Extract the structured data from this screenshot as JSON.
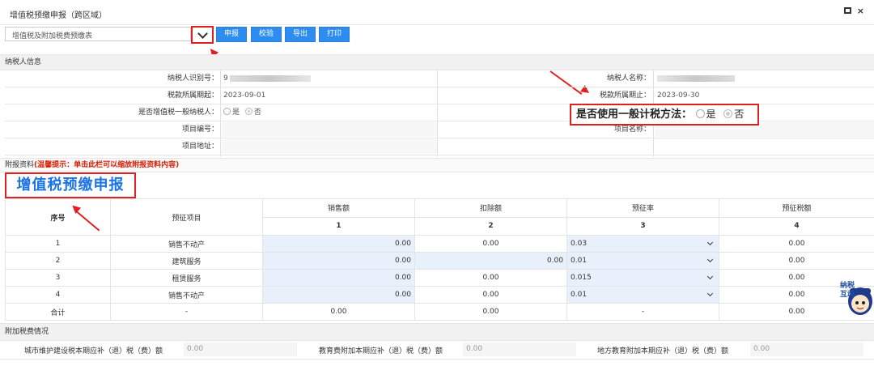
{
  "window": {
    "title": "增值税预缴申报（跨区域）"
  },
  "toolbar": {
    "form_select": "增值税及附加税费预缴表",
    "buttons": {
      "declare": "申报",
      "verify": "校验",
      "export": "导出",
      "print": "打印"
    }
  },
  "taxpayer_section": {
    "title": "纳税人信息",
    "taxpayer_id_label": "纳税人识别号：",
    "taxpayer_id_value": "9",
    "taxpayer_name_label": "纳税人名称：",
    "period_start_label": "税款所属期起：",
    "period_start_value": "2023-09-01",
    "period_end_label": "税款所属期止：",
    "period_end_value": "2023-09-30",
    "general_taxpayer_label": "是否增值税一般纳税人：",
    "general_taxpayer_options": [
      "是",
      "否"
    ],
    "general_taxpayer_selected": "否",
    "project_no_label": "项目编号：",
    "project_name_label": "项目名称：",
    "project_address_label": "项目地址："
  },
  "callout": {
    "label": "是否使用一般计税方法：",
    "options": [
      "是",
      "否"
    ],
    "selected": "否"
  },
  "attachment": {
    "prefix": "附报资料",
    "tip": "(温馨提示：单击此栏可以缩放附报资料内容)"
  },
  "big_title": "增值税预缴申报",
  "table": {
    "headers": {
      "seq": "序号",
      "item": "预征项目",
      "sales": "销售额",
      "deduction": "扣除额",
      "rate": "预征率",
      "tax": "预征税额"
    },
    "col_numbers": [
      "1",
      "2",
      "3",
      "4"
    ],
    "rows": [
      {
        "seq": "1",
        "item": "销售不动产",
        "sales": "0.00",
        "deduction": "0.00",
        "rate": "0.03",
        "tax": "0.00"
      },
      {
        "seq": "2",
        "item": "建筑服务",
        "sales": "0.00",
        "deduction": "0.00",
        "rate": "0.01",
        "tax": "0.00"
      },
      {
        "seq": "3",
        "item": "租赁服务",
        "sales": "0.00",
        "deduction": "0.00",
        "rate": "0.015",
        "tax": "0.00"
      },
      {
        "seq": "4",
        "item": "销售不动产",
        "sales": "0.00",
        "deduction": "0.00",
        "rate": "0.01",
        "tax": "0.00"
      }
    ],
    "total": {
      "label": "合计",
      "item": "-",
      "sales": "0.00",
      "deduction": "0.00",
      "rate": "-",
      "tax": "0.00"
    }
  },
  "surcharge_section": {
    "title": "附加税费情况",
    "urban_label": "城市维护建设税本期应补（退）税（费）额",
    "urban_value": "0.00",
    "edu_label": "教育费附加本期应补（退）税（费）额",
    "edu_value": "0.00",
    "local_edu_label": "地方教育附加本期应补（退）税（费）额",
    "local_edu_value": "0.00"
  },
  "mascot": {
    "text": "纳税互动"
  },
  "colors": {
    "accent": "#2d8cf0",
    "highlight": "#e02020",
    "title_blue": "#1a73e8"
  }
}
